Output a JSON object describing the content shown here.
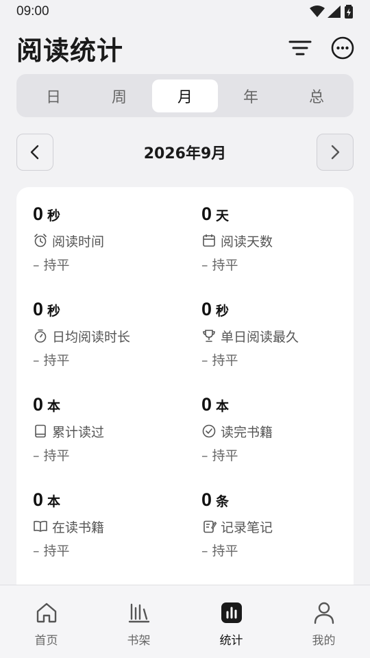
{
  "status_bar": {
    "time": "09:00"
  },
  "header": {
    "title": "阅读统计",
    "filter_icon": "filter-icon",
    "more_icon": "more-icon"
  },
  "period_tabs": {
    "items": [
      "日",
      "周",
      "月",
      "年",
      "总"
    ],
    "selected": "月"
  },
  "period": {
    "label": "2026年9月"
  },
  "stats": [
    {
      "value": "0",
      "unit": "秒",
      "icon": "alarm-icon",
      "label": "阅读时间",
      "trend": "– 持平"
    },
    {
      "value": "0",
      "unit": "天",
      "icon": "calendar-icon",
      "label": "阅读天数",
      "trend": "– 持平"
    },
    {
      "value": "0",
      "unit": "秒",
      "icon": "timer-icon",
      "label": "日均阅读时长",
      "trend": "– 持平"
    },
    {
      "value": "0",
      "unit": "秒",
      "icon": "trophy-icon",
      "label": "单日阅读最久",
      "trend": "– 持平"
    },
    {
      "value": "0",
      "unit": "本",
      "icon": "book-icon",
      "label": "累计读过",
      "trend": "– 持平"
    },
    {
      "value": "0",
      "unit": "本",
      "icon": "check-circle-icon",
      "label": "读完书籍",
      "trend": "– 持平"
    },
    {
      "value": "0",
      "unit": "本",
      "icon": "open-book-icon",
      "label": "在读书籍",
      "trend": "– 持平"
    },
    {
      "value": "0",
      "unit": "条",
      "icon": "note-icon",
      "label": "记录笔记",
      "trend": "– 持平"
    }
  ],
  "bottom_nav": {
    "items": [
      {
        "label": "首页",
        "icon": "home-icon"
      },
      {
        "label": "书架",
        "icon": "bookshelf-icon"
      },
      {
        "label": "统计",
        "icon": "stats-icon"
      },
      {
        "label": "我的",
        "icon": "profile-icon"
      }
    ],
    "active": "统计"
  }
}
